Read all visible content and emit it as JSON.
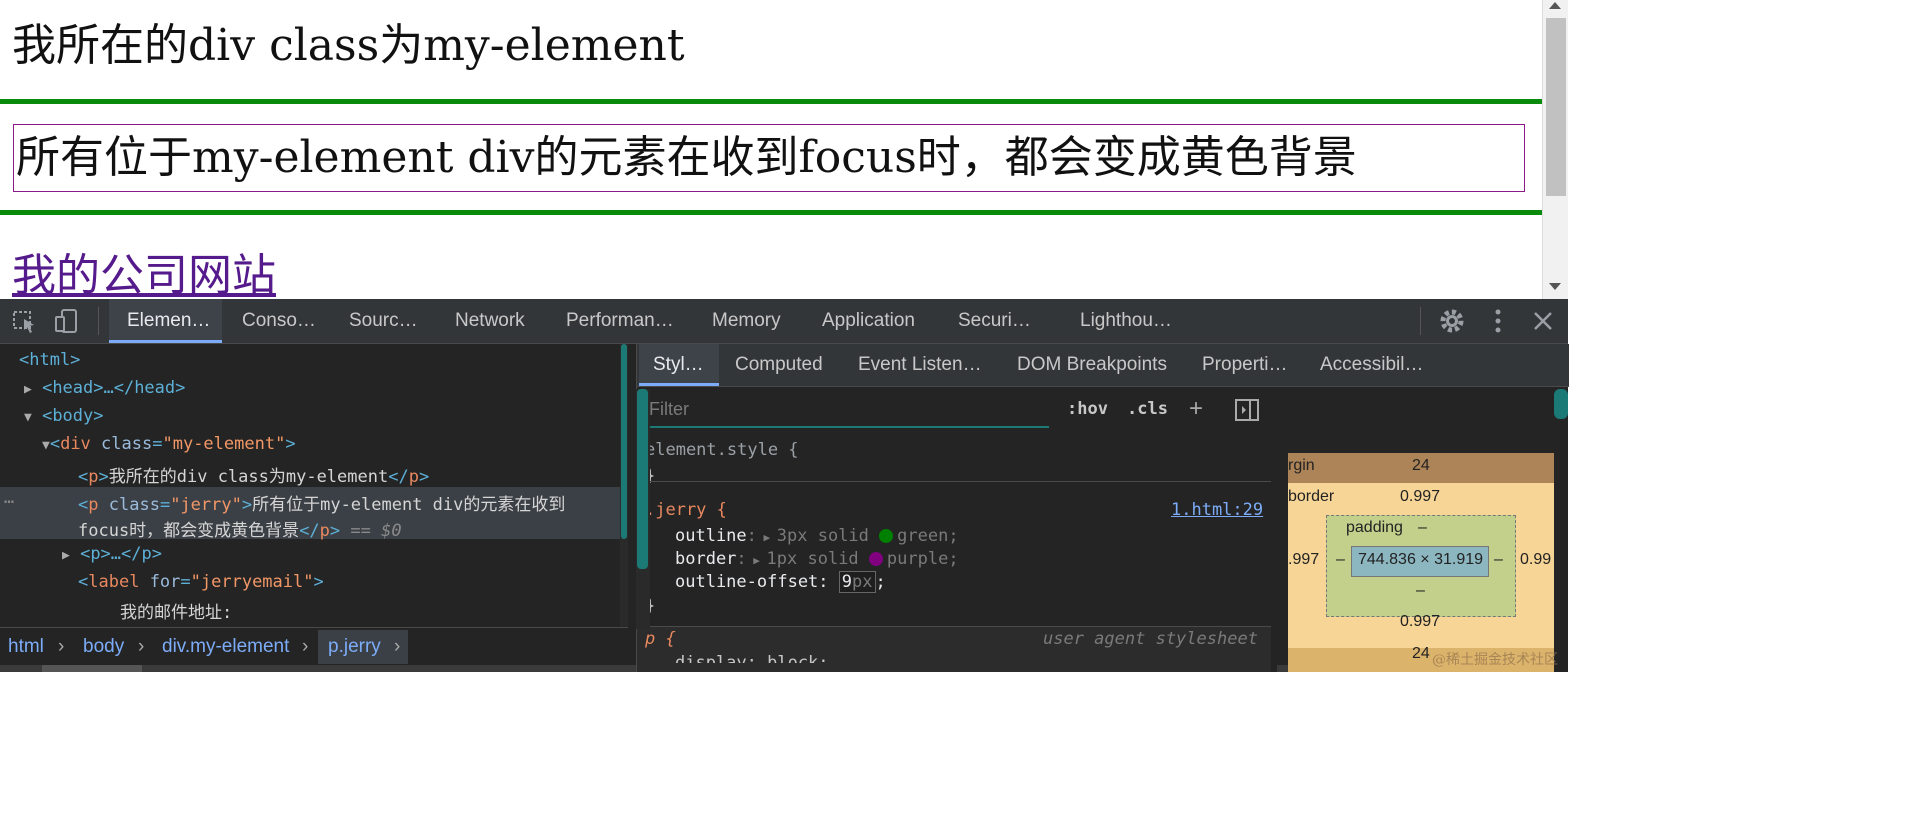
{
  "page": {
    "p1_text": "我所在的div class为my-element",
    "p2_text": "所有位于my-element div的元素在收到focus时，都会变成黄色背景",
    "link_text": "我的公司网站"
  },
  "devtools": {
    "tabs": [
      "Elemen…",
      "Conso…",
      "Sourc…",
      "Network",
      "Performan…",
      "Memory",
      "Application",
      "Securi…",
      "Lighthou…"
    ],
    "active_tab": "Elemen…",
    "dom": {
      "html": "<html>",
      "head": "<head>…</head>",
      "body": "<body>",
      "div_tag": "div",
      "div_attr": "class",
      "div_val": "\"my-element\"",
      "p1_inner": "我所在的div class为my-element",
      "p_jerry_attr": "class",
      "p_jerry_val": "\"jerry\"",
      "p_jerry_text1": "所有位于my-element div的元素在收到",
      "p_jerry_text2": "focus时，都会变成黄色背景",
      "eq0": "== $0",
      "p_collapsed": "<p>…</p>",
      "label_attr": "for",
      "label_val": "\"jerryemail\"",
      "label_text": "我的邮件地址:"
    },
    "breadcrumb": [
      "html",
      "body",
      "div.my-element",
      "p.jerry"
    ],
    "styles_tabs": [
      "Styl…",
      "Computed",
      "Event Listen…",
      "DOM Breakpoints",
      "Properti…",
      "Accessibil…"
    ],
    "filter_placeholder": "Filter",
    "hov": ":hov",
    "cls": ".cls",
    "element_style": "element.style {",
    "close_brace": "}",
    "jerry_selector": ".jerry {",
    "jerry_source": "1.html:29",
    "outline_prop": "outline",
    "outline_val": "3px solid",
    "outline_color_name": "green;",
    "border_prop": "border",
    "border_val": "1px solid",
    "border_color_name": "purple;",
    "offset_prop": "outline-offset",
    "offset_val_num": "9",
    "offset_val_unit": "px",
    "semicolon": ";",
    "p_selector": "p {",
    "uas": "user agent stylesheet",
    "p_next_line": "display: block;",
    "colors": {
      "green": "#008000",
      "purple": "#800080"
    },
    "box_model": {
      "margin_label": "rgin",
      "margin_top": "24",
      "border_label": "border",
      "border_top": "0.997",
      "padding_label": "padding",
      "padding_top": "–",
      "content": "744.836 × 31.919",
      "left_outer": ".997",
      "left_dash": "–",
      "right_dash": "–",
      "right_outer": "0.99",
      "padding_bottom": "–",
      "border_bottom": "0.997",
      "margin_bottom": "24"
    }
  },
  "watermark": "@稀土掘金技术社区"
}
